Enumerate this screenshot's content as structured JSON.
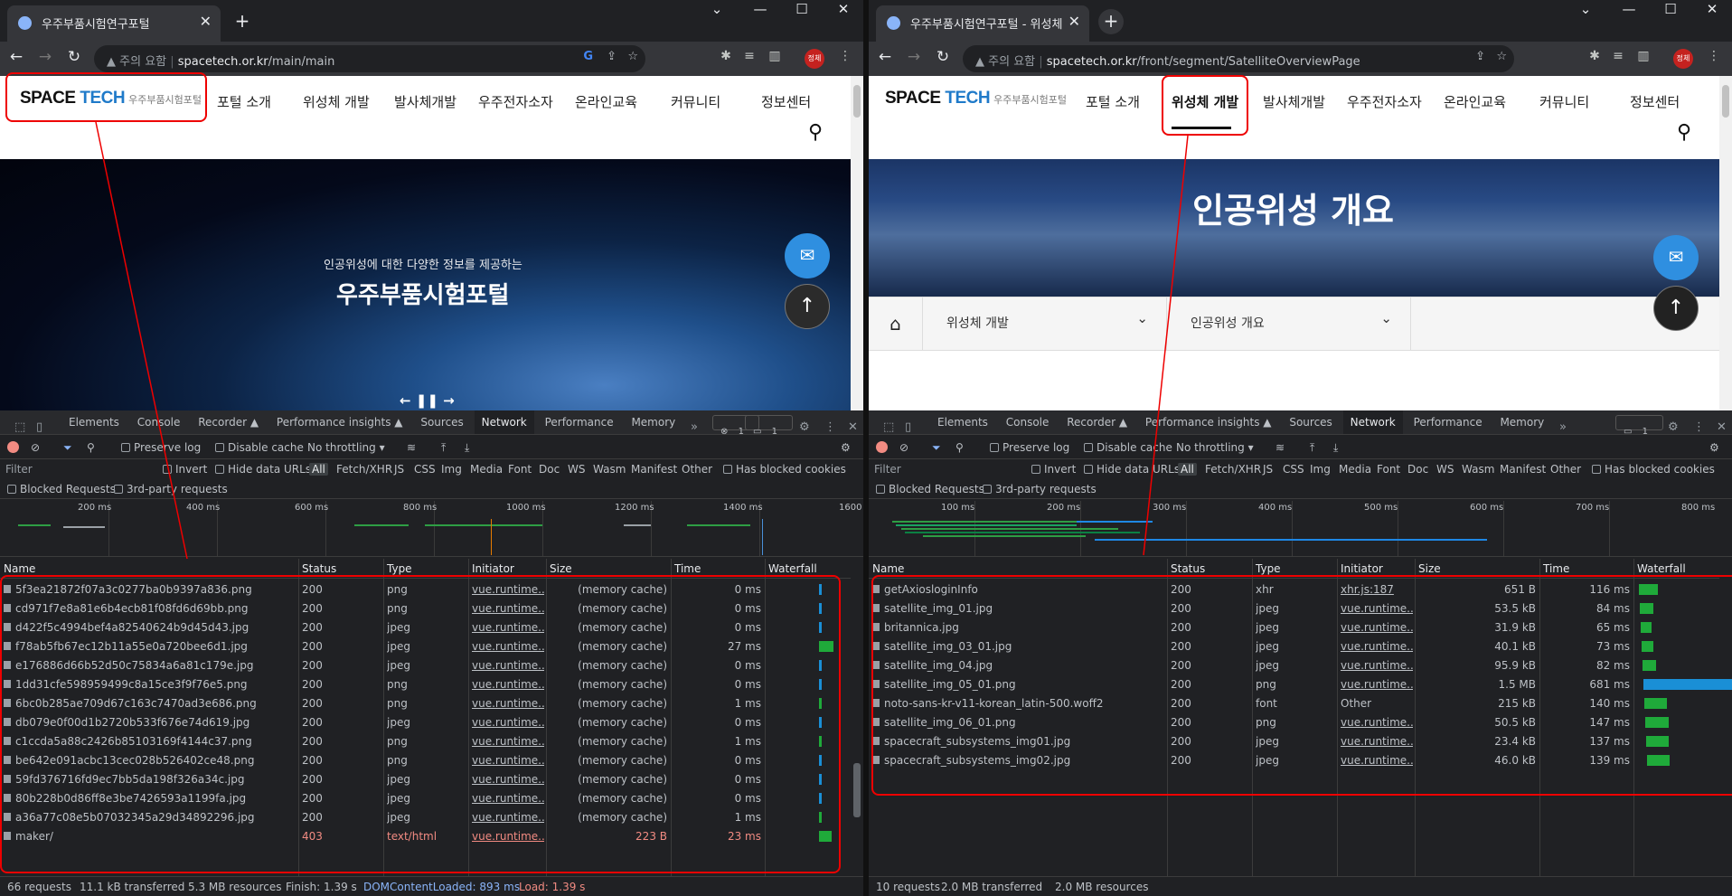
{
  "left": {
    "tab_title": "우주부품시험연구포털",
    "address": {
      "warning": "주의 요함",
      "host": "spacetech.or.kr",
      "path": "/main/main"
    },
    "profile": "정체",
    "site": {
      "logo": {
        "text_a": "SPACE",
        "text_b": "TECH",
        "sub": "우주부품시험포털"
      },
      "menu": [
        "포털 소개",
        "위성체 개발",
        "발사체개발",
        "우주전자소자",
        "온라인교육",
        "커뮤니티",
        "정보센터"
      ],
      "hero_subtitle": "인공위성에 대한 다양한 정보를 제공하는",
      "hero_title": "우주부품시험포털",
      "slider": "← ❚❚ →"
    },
    "devtools": {
      "tabs": [
        "Elements",
        "Console",
        "Recorder ▲",
        "Performance insights ▲",
        "Sources",
        "Network",
        "Performance",
        "Memory"
      ],
      "badge_errors": "1",
      "badge_issues": "1",
      "toolbar": {
        "preserve_log": "Preserve log",
        "disable_cache": "Disable cache",
        "throttling": "No throttling"
      },
      "filter": {
        "placeholder": "Filter",
        "invert": "Invert",
        "hide_urls": "Hide data URLs",
        "types": [
          "All",
          "Fetch/XHR",
          "JS",
          "CSS",
          "Img",
          "Media",
          "Font",
          "Doc",
          "WS",
          "Wasm",
          "Manifest",
          "Other"
        ],
        "blocked_cookies": "Has blocked cookies"
      },
      "blocked": {
        "blocked_requests": "Blocked Requests",
        "third_party": "3rd-party requests"
      },
      "overview_ticks": [
        "200 ms",
        "400 ms",
        "600 ms",
        "800 ms",
        "1000 ms",
        "1200 ms",
        "1400 ms",
        "1600"
      ],
      "columns": [
        "Name",
        "Status",
        "Type",
        "Initiator",
        "Size",
        "Time",
        "Waterfall"
      ],
      "rows": [
        {
          "name": "5f3ea21872f07a3c0277ba0b9397a836.png",
          "status": "200",
          "type": "png",
          "initiator": "vue.runtime....",
          "size": "(memory cache)",
          "time": "0 ms"
        },
        {
          "name": "cd971f7e8a81e6b4ecb81f08fd6d69bb.png",
          "status": "200",
          "type": "png",
          "initiator": "vue.runtime....",
          "size": "(memory cache)",
          "time": "0 ms"
        },
        {
          "name": "d422f5c4994bef4a82540624b9d45d43.jpg",
          "status": "200",
          "type": "jpeg",
          "initiator": "vue.runtime....",
          "size": "(memory cache)",
          "time": "0 ms"
        },
        {
          "name": "f78ab5fb67ec12b11a55e0a720bee6d1.jpg",
          "status": "200",
          "type": "jpeg",
          "initiator": "vue.runtime....",
          "size": "(memory cache)",
          "time": "27 ms"
        },
        {
          "name": "e176886d66b52d50c75834a6a81c179e.jpg",
          "status": "200",
          "type": "jpeg",
          "initiator": "vue.runtime....",
          "size": "(memory cache)",
          "time": "0 ms"
        },
        {
          "name": "1dd31cfe598959499c8a15ce3f9f76e5.png",
          "status": "200",
          "type": "png",
          "initiator": "vue.runtime....",
          "size": "(memory cache)",
          "time": "0 ms"
        },
        {
          "name": "6bc0b285ae709d67c163c7470ad3e686.png",
          "status": "200",
          "type": "png",
          "initiator": "vue.runtime....",
          "size": "(memory cache)",
          "time": "1 ms"
        },
        {
          "name": "db079e0f00d1b2720b533f676e74d619.jpg",
          "status": "200",
          "type": "jpeg",
          "initiator": "vue.runtime....",
          "size": "(memory cache)",
          "time": "0 ms"
        },
        {
          "name": "c1ccda5a88c2426b85103169f4144c37.png",
          "status": "200",
          "type": "png",
          "initiator": "vue.runtime....",
          "size": "(memory cache)",
          "time": "1 ms"
        },
        {
          "name": "be642e091acbc13cec028b526402ce48.png",
          "status": "200",
          "type": "png",
          "initiator": "vue.runtime....",
          "size": "(memory cache)",
          "time": "0 ms"
        },
        {
          "name": "59fd376716fd9ec7bb5da198f326a34c.jpg",
          "status": "200",
          "type": "jpeg",
          "initiator": "vue.runtime....",
          "size": "(memory cache)",
          "time": "0 ms"
        },
        {
          "name": "80b228b0d86ff8e3be7426593a1199fa.jpg",
          "status": "200",
          "type": "jpeg",
          "initiator": "vue.runtime....",
          "size": "(memory cache)",
          "time": "0 ms"
        },
        {
          "name": "a36a77c08e5b07032345a29d34892296.jpg",
          "status": "200",
          "type": "jpeg",
          "initiator": "vue.runtime....",
          "size": "(memory cache)",
          "time": "1 ms"
        },
        {
          "name": "maker/",
          "status": "403",
          "type": "text/html",
          "initiator": "vue.runtime....",
          "size": "223 B",
          "time": "23 ms",
          "error": true
        }
      ],
      "status_bar": {
        "requests": "66 requests",
        "transferred": "11.1 kB transferred",
        "resources": "5.3 MB resources",
        "finish": "Finish: 1.39 s",
        "dcl": "DOMContentLoaded: 893 ms",
        "load": "Load: 1.39 s"
      }
    }
  },
  "right": {
    "tab_title": "우주부품시험연구포털 - 위성체",
    "address": {
      "warning": "주의 요함",
      "host": "spacetech.or.kr",
      "path": "/front/segment/SatelliteOverviewPage"
    },
    "profile": "정체",
    "site": {
      "logo": {
        "text_a": "SPACE",
        "text_b": "TECH",
        "sub": "우주부품시험포털"
      },
      "menu": [
        "포털 소개",
        "위성체 개발",
        "발사체개발",
        "우주전자소자",
        "온라인교육",
        "커뮤니티",
        "정보센터"
      ],
      "hero_title": "인공위성 개요",
      "breadcrumb": [
        "위성체 개발",
        "인공위성 개요"
      ]
    },
    "devtools": {
      "tabs": [
        "Elements",
        "Console",
        "Recorder ▲",
        "Performance insights ▲",
        "Sources",
        "Network",
        "Performance",
        "Memory"
      ],
      "badge_issues": "1",
      "toolbar": {
        "preserve_log": "Preserve log",
        "disable_cache": "Disable cache",
        "throttling": "No throttling"
      },
      "filter": {
        "placeholder": "Filter",
        "invert": "Invert",
        "hide_urls": "Hide data URLs",
        "types": [
          "All",
          "Fetch/XHR",
          "JS",
          "CSS",
          "Img",
          "Media",
          "Font",
          "Doc",
          "WS",
          "Wasm",
          "Manifest",
          "Other"
        ],
        "blocked_cookies": "Has blocked cookies"
      },
      "blocked": {
        "blocked_requests": "Blocked Requests",
        "third_party": "3rd-party requests"
      },
      "overview_ticks": [
        "100 ms",
        "200 ms",
        "300 ms",
        "400 ms",
        "500 ms",
        "600 ms",
        "700 ms",
        "800 ms"
      ],
      "columns": [
        "Name",
        "Status",
        "Type",
        "Initiator",
        "Size",
        "Time",
        "Waterfall"
      ],
      "rows": [
        {
          "name": "getAxiosloginInfo",
          "status": "200",
          "type": "xhr",
          "initiator": "xhr.js:187",
          "size": "651 B",
          "time": "116 ms"
        },
        {
          "name": "satellite_img_01.jpg",
          "status": "200",
          "type": "jpeg",
          "initiator": "vue.runtime....",
          "size": "53.5 kB",
          "time": "84 ms"
        },
        {
          "name": "britannica.jpg",
          "status": "200",
          "type": "jpeg",
          "initiator": "vue.runtime....",
          "size": "31.9 kB",
          "time": "65 ms"
        },
        {
          "name": "satellite_img_03_01.jpg",
          "status": "200",
          "type": "jpeg",
          "initiator": "vue.runtime....",
          "size": "40.1 kB",
          "time": "73 ms"
        },
        {
          "name": "satellite_img_04.jpg",
          "status": "200",
          "type": "jpeg",
          "initiator": "vue.runtime....",
          "size": "95.9 kB",
          "time": "82 ms"
        },
        {
          "name": "satellite_img_05_01.png",
          "status": "200",
          "type": "png",
          "initiator": "vue.runtime....",
          "size": "1.5 MB",
          "time": "681 ms"
        },
        {
          "name": "noto-sans-kr-v11-korean_latin-500.woff2",
          "status": "200",
          "type": "font",
          "initiator": "Other",
          "size": "215 kB",
          "time": "140 ms",
          "plain_initiator": true
        },
        {
          "name": "satellite_img_06_01.png",
          "status": "200",
          "type": "png",
          "initiator": "vue.runtime....",
          "size": "50.5 kB",
          "time": "147 ms"
        },
        {
          "name": "spacecraft_subsystems_img01.jpg",
          "status": "200",
          "type": "jpeg",
          "initiator": "vue.runtime....",
          "size": "23.4 kB",
          "time": "137 ms"
        },
        {
          "name": "spacecraft_subsystems_img02.jpg",
          "status": "200",
          "type": "jpeg",
          "initiator": "vue.runtime....",
          "size": "46.0 kB",
          "time": "139 ms"
        }
      ],
      "status_bar": {
        "requests": "10 requests",
        "transferred": "2.0 MB transferred",
        "resources": "2.0 MB resources"
      }
    }
  }
}
